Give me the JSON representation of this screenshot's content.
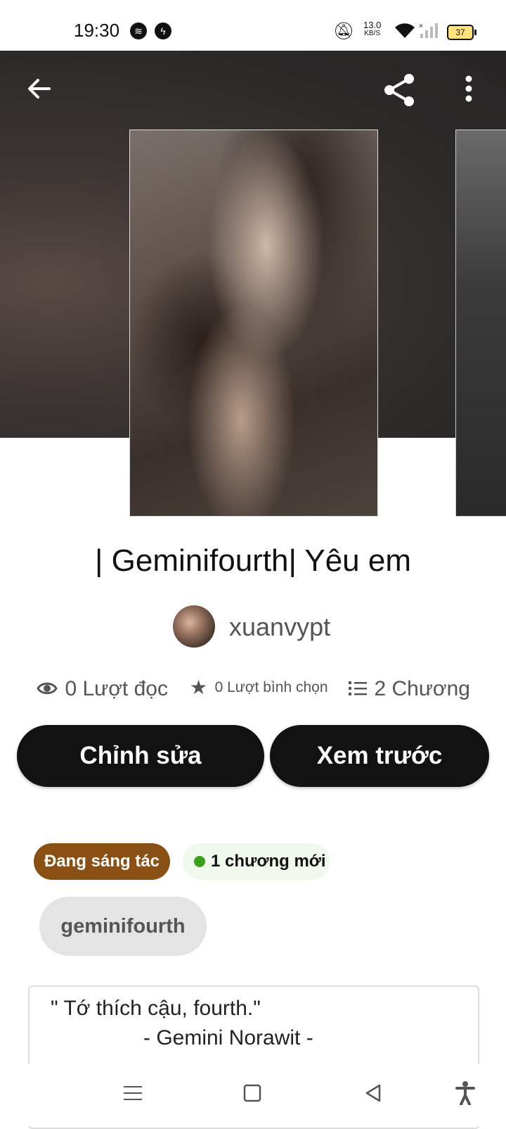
{
  "status_bar": {
    "time": "19:30",
    "net_speed_value": "13.0",
    "net_speed_unit": "KB/S",
    "battery": "37",
    "icons": [
      "spotify-icon",
      "messenger-icon",
      "mute-vibrate-icon",
      "wifi-icon",
      "signal-icon"
    ]
  },
  "header": {
    "back_icon": "arrow-left-icon",
    "share_icon": "share-icon",
    "more_icon": "more-vertical-icon"
  },
  "story": {
    "title": "| Geminifourth| Yêu em",
    "author": "xuanvypt"
  },
  "stats": {
    "reads": "0 Lượt đọc",
    "votes": "0 Lượt bình chọn",
    "chapters": "2 Chương"
  },
  "actions": {
    "edit_label": "Chỉnh sửa",
    "preview_label": "Xem trước"
  },
  "badges": {
    "status": "Đang sáng tác",
    "new_chapters": "1 chương mới"
  },
  "tags": [
    "geminifourth"
  ],
  "description": {
    "line1": "\" Tớ thích cậu, fourth.\"",
    "line2": "- Gemini Norawit -"
  },
  "colors": {
    "status_badge": "#8a4f12",
    "button_bg": "#121212",
    "new_dot": "#3aa11a"
  }
}
